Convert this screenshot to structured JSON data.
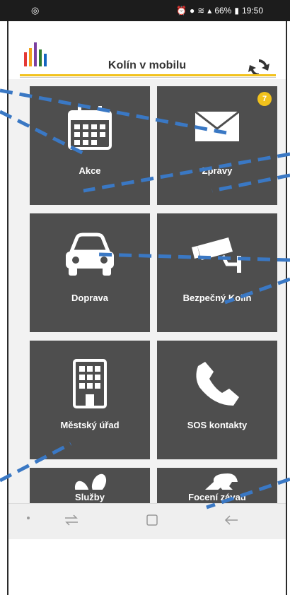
{
  "status": {
    "left_icon": "notification-icon",
    "battery": "66%",
    "time": "19:50"
  },
  "header": {
    "title": "Kolín v mobilu"
  },
  "tiles": [
    {
      "label": "Akce",
      "icon": "calendar-icon"
    },
    {
      "label": "Zprávy",
      "icon": "envelope-icon",
      "badge": "7"
    },
    {
      "label": "Doprava",
      "icon": "car-icon"
    },
    {
      "label": "Bezpečný Kolín",
      "icon": "security-camera-icon"
    },
    {
      "label": "Městský úřad",
      "icon": "building-icon"
    },
    {
      "label": "SOS kontakty",
      "icon": "phone-icon"
    },
    {
      "label": "Služby",
      "icon": "footsteps-icon"
    },
    {
      "label": "Focení závad",
      "icon": "wrench-icon"
    }
  ],
  "navbar": {
    "items": [
      "dot-icon",
      "recent-apps-icon",
      "home-icon",
      "back-icon"
    ]
  },
  "colors": {
    "tile": "#4e4e4e",
    "accent": "#f2c21c",
    "annotation": "#3a78c4"
  }
}
